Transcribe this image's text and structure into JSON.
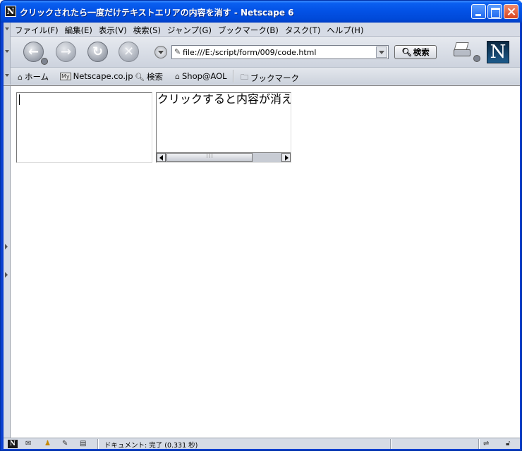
{
  "window": {
    "title": "クリックされたら一度だけテキストエリアの内容を消す - Netscape 6",
    "app_icon_letter": "N"
  },
  "menubar": {
    "items": [
      {
        "label": "ファイル(F)"
      },
      {
        "label": "編集(E)"
      },
      {
        "label": "表示(V)"
      },
      {
        "label": "検索(S)"
      },
      {
        "label": "ジャンプ(G)"
      },
      {
        "label": "ブックマーク(B)"
      },
      {
        "label": "タスク(T)"
      },
      {
        "label": "ヘルプ(H)"
      }
    ]
  },
  "navbar": {
    "back_icon": "←",
    "forward_icon": "→",
    "reload_icon": "↻",
    "stop_icon": "✕",
    "url": "file:///E:/script/form/009/code.html",
    "search_label": "検索",
    "logo_letter": "N"
  },
  "personalbar": {
    "home": "ホーム",
    "netscape": "Netscape.co.jp",
    "netscape_badge": "My",
    "search": "検索",
    "shop": "Shop@AOL",
    "bookmarks": "ブックマーク"
  },
  "page": {
    "textarea_left_value": "",
    "textarea_right_value": "クリックすると内容が消え"
  },
  "statusbar": {
    "netscape_letter": "N",
    "text": "ドキュメント: 完了 (0.331 秒)"
  },
  "colors": {
    "titlebar": "#0352e6",
    "chrome": "#d6dbe5",
    "content_bg": "#ffffff"
  }
}
